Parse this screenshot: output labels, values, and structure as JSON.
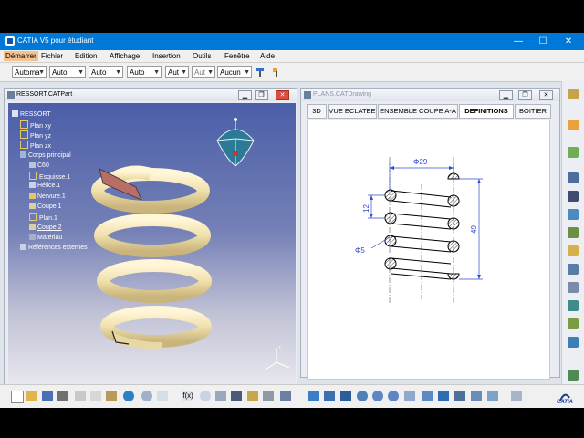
{
  "window": {
    "title": "CATIA V5 pour étudiant"
  },
  "menu": [
    "Démarrer",
    "Fichier",
    "Edition",
    "Affichage",
    "Insertion",
    "Outils",
    "Fenêtre",
    "Aide"
  ],
  "toolbar": {
    "combos": [
      "Automa",
      "Auto",
      "Auto",
      "Auto",
      "Aut",
      "Aut",
      "Aucun"
    ]
  },
  "part_window": {
    "title": "RESSORT.CATPart",
    "tree": [
      "RESSORT",
      "Plan xy",
      "Plan yz",
      "Plan zx",
      "Corps principal",
      "C60",
      "Esquisse.1",
      "Hélice.1",
      "Nervure.1",
      "Coupe.1",
      "Plan.1",
      "Coupe.2",
      "Matériau",
      "Références externes"
    ]
  },
  "drawing_window": {
    "title": "PLANS.CATDrawing",
    "tabs": [
      "3D",
      "VUE ECLATEE",
      "ENSEMBLE COUPE A-A",
      "DEFINITIONS",
      "BOITIER"
    ],
    "dims": {
      "diameter_top": "Φ29",
      "pitch": "12",
      "height": "49",
      "wire": "Φ5"
    }
  },
  "brand": "CATIA",
  "colors": {
    "titlebar": "#0078d7",
    "spring": "#f1e3b1",
    "section": "#b96d67"
  }
}
